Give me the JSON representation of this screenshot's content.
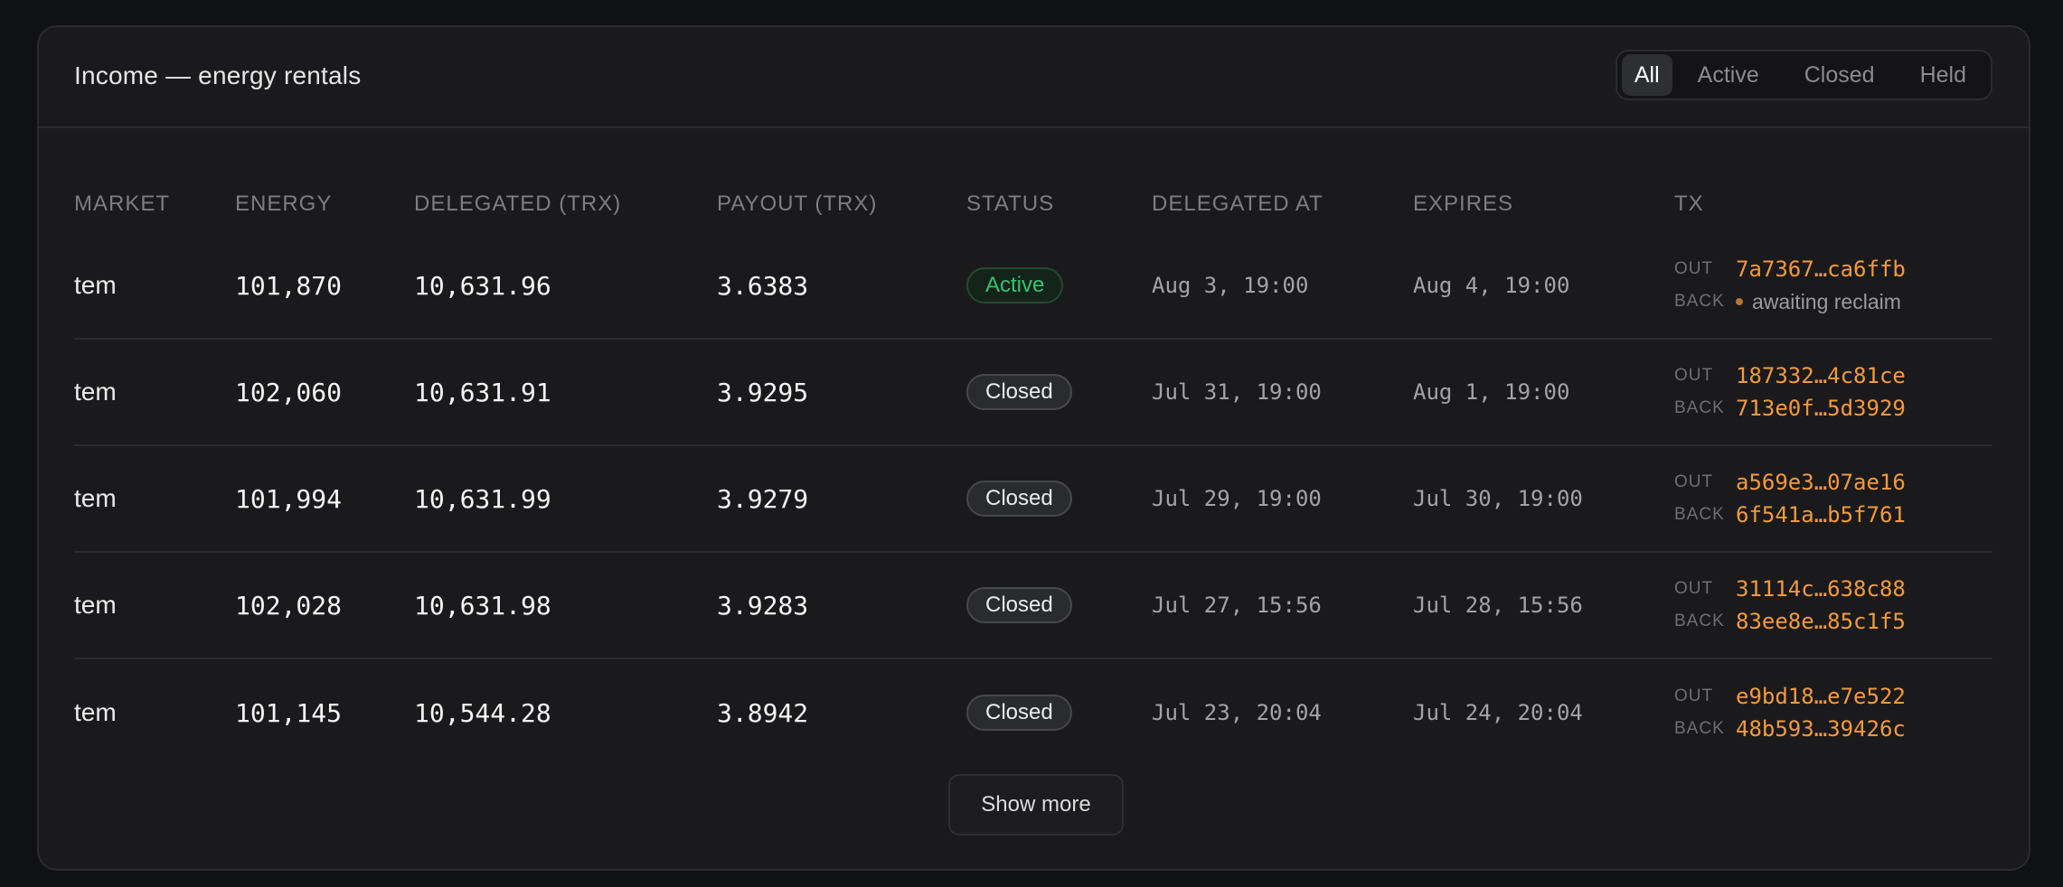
{
  "title": "Income — energy rentals",
  "filters": [
    {
      "label": "All",
      "selected": true
    },
    {
      "label": "Active",
      "selected": false
    },
    {
      "label": "Closed",
      "selected": false
    },
    {
      "label": "Held",
      "selected": false
    }
  ],
  "columns": [
    "MARKET",
    "ENERGY",
    "DELEGATED (TRX)",
    "PAYOUT (TRX)",
    "STATUS",
    "DELEGATED AT",
    "EXPIRES",
    "TX"
  ],
  "tx_labels": {
    "out": "OUT",
    "back": "BACK"
  },
  "rows": [
    {
      "market": "tem",
      "energy": "101,870",
      "delegated": "10,631.96",
      "payout": "3.6383",
      "status": "Active",
      "delegated_at": "Aug 3, 19:00",
      "expires": "Aug 4, 19:00",
      "tx_out": "7a7367…ca6ffb",
      "tx_back": "awaiting reclaim",
      "back_pending": true
    },
    {
      "market": "tem",
      "energy": "102,060",
      "delegated": "10,631.91",
      "payout": "3.9295",
      "status": "Closed",
      "delegated_at": "Jul 31, 19:00",
      "expires": "Aug 1, 19:00",
      "tx_out": "187332…4c81ce",
      "tx_back": "713e0f…5d3929",
      "back_pending": false
    },
    {
      "market": "tem",
      "energy": "101,994",
      "delegated": "10,631.99",
      "payout": "3.9279",
      "status": "Closed",
      "delegated_at": "Jul 29, 19:00",
      "expires": "Jul 30, 19:00",
      "tx_out": "a569e3…07ae16",
      "tx_back": "6f541a…b5f761",
      "back_pending": false
    },
    {
      "market": "tem",
      "energy": "102,028",
      "delegated": "10,631.98",
      "payout": "3.9283",
      "status": "Closed",
      "delegated_at": "Jul 27, 15:56",
      "expires": "Jul 28, 15:56",
      "tx_out": "31114c…638c88",
      "tx_back": "83ee8e…85c1f5",
      "back_pending": false
    },
    {
      "market": "tem",
      "energy": "101,145",
      "delegated": "10,544.28",
      "payout": "3.8942",
      "status": "Closed",
      "delegated_at": "Jul 23, 20:04",
      "expires": "Jul 24, 20:04",
      "tx_out": "e9bd18…e7e522",
      "tx_back": "48b593…39426c",
      "back_pending": false
    }
  ],
  "show_more_label": "Show more",
  "colors": {
    "background": "#0f1115",
    "card": "#1a1a1c",
    "accent_hash": "#f39a3c",
    "status_active": "#34c46f",
    "pending_dot": "#b87531"
  }
}
